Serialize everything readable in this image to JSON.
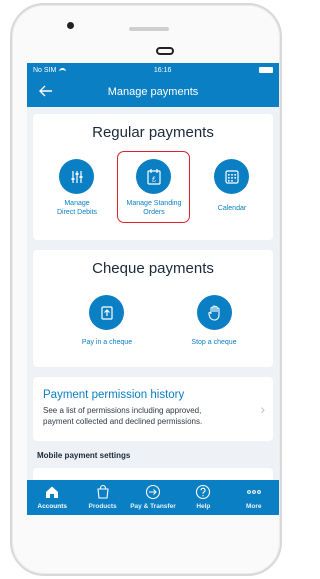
{
  "status": {
    "carrier": "No SIM",
    "time": "16:16"
  },
  "header": {
    "title": "Manage payments",
    "back_icon": "back-arrow-icon"
  },
  "regular": {
    "title": "Regular payments",
    "options": [
      {
        "label_line1": "Manage",
        "label_line2": "Direct Debits",
        "icon": "sliders-icon"
      },
      {
        "label_line1": "Manage Standing",
        "label_line2": "Orders",
        "icon": "standing-order-icon"
      },
      {
        "label_line1": "Calendar",
        "label_line2": "",
        "icon": "calendar-icon"
      }
    ]
  },
  "cheque": {
    "title": "Cheque payments",
    "options": [
      {
        "label": "Pay in a cheque",
        "icon": "pay-in-cheque-icon"
      },
      {
        "label": "Stop a cheque",
        "icon": "stop-hand-icon"
      }
    ]
  },
  "permission": {
    "title": "Payment permission history",
    "description": "See a list of permissions including approved, payment collected and declined permissions."
  },
  "mobile_settings": {
    "label": "Mobile payment settings"
  },
  "tabs": [
    {
      "label": "Accounts",
      "icon": "home-icon"
    },
    {
      "label": "Products",
      "icon": "shopping-bag-icon"
    },
    {
      "label": "Pay & Transfer",
      "icon": "transfer-arrow-icon"
    },
    {
      "label": "Help",
      "icon": "help-icon"
    },
    {
      "label": "More",
      "icon": "more-dots-icon"
    }
  ],
  "colors": {
    "brand": "#0a7fc3",
    "highlight": "#d9232e"
  }
}
